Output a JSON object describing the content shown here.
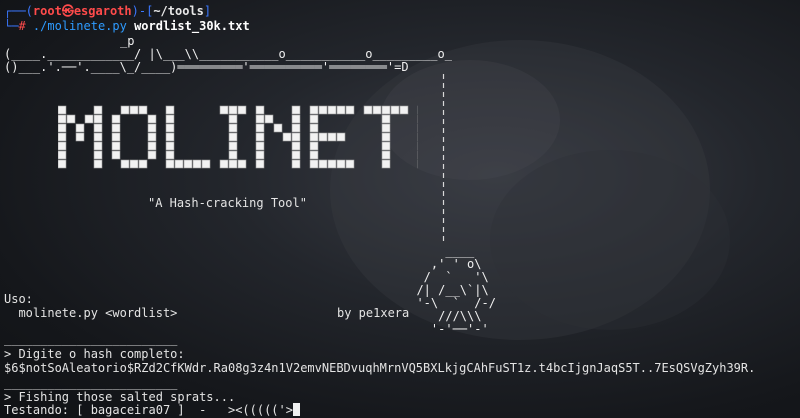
{
  "prompt": {
    "frame_top_left": "┌──(",
    "user": "root",
    "at": "㉿",
    "host": "esgaroth",
    "frame_mid": ")-[",
    "path": "~/tools",
    "frame_top_right": "]",
    "frame_bottom": "└─",
    "hash": "#",
    "command": "./molinete.py",
    "argument": "wordlist_30k.txt"
  },
  "art": {
    "rod_tip": "_p",
    "rod_line": "(____.____________/ |\\___\\\\___________o___________o_________o_",
    "reel_line": "()___.'.──'.____\\_/____)═════════'══════════'════════'=D",
    "tagline": "\"A Hash-cracking Tool\"",
    "lure": [
      "      ____",
      "    ,' ' o\\",
      "   /  `   '\\",
      "  /| /__\\`|\\",
      "  '-\\  `  /-/",
      "     ///\\\\\\",
      "    '-'──'-'"
    ]
  },
  "banner_title": "MOLINETE",
  "usage": {
    "label": "Uso:",
    "syntax": "  molinete.py <wordlist>",
    "author": "by pe1xera"
  },
  "separator": "________________________",
  "hash_prompt": "> Digite o hash completo:",
  "hash_value": "$6$notSoAleatorio$RZd2CfKWdr.Ra08g3z4n1V2emvNEBDvuqhMrnVQ5BXLkjgCAhFuST1z.t4bcIjgnJaqS5T..7EsQSVgZyh39R.",
  "fishing": "> Fishing those salted sprats...",
  "testing": "Testando: [ bagaceira07 ]  -   ><((((('>"
}
